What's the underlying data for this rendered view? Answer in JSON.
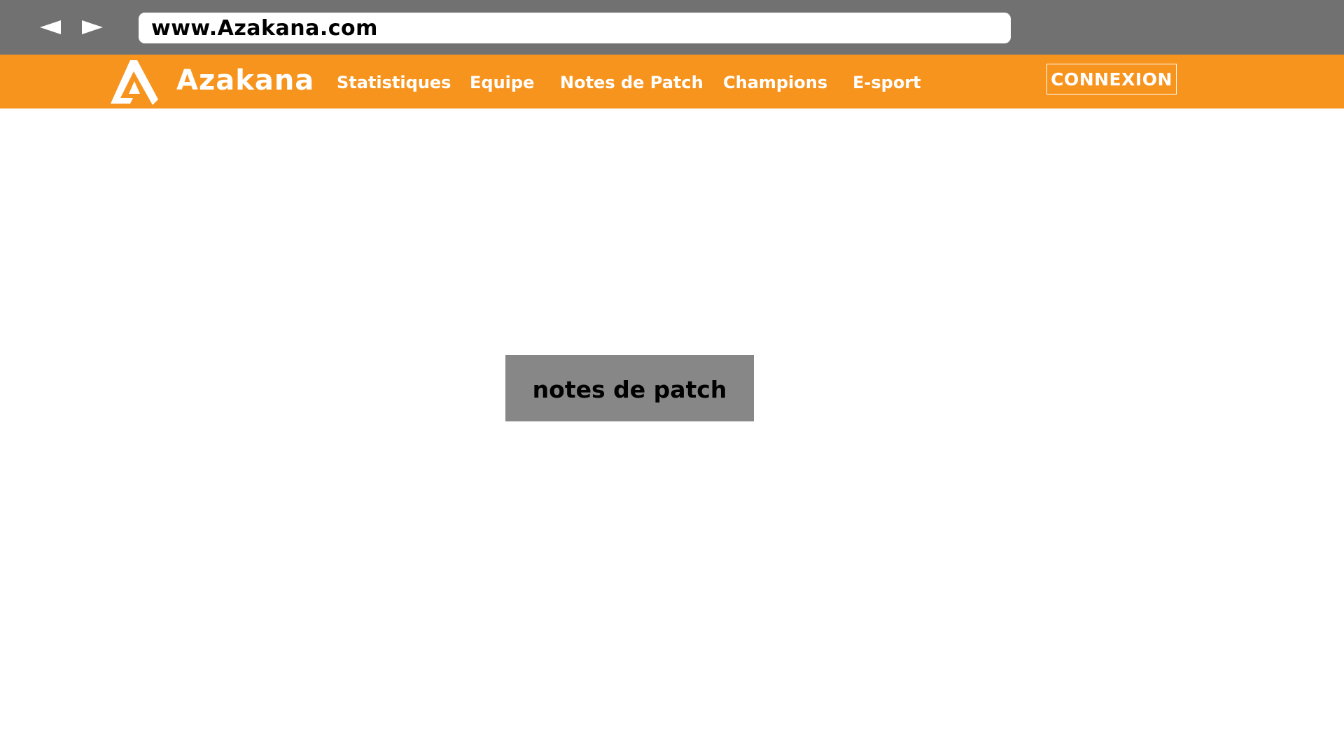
{
  "browser": {
    "back_icon": "triangle-left-icon",
    "forward_icon": "triangle-right-icon",
    "url": "www.Azakana.com"
  },
  "header": {
    "logo_icon": "azakana-a-logo",
    "brand": "Azakana",
    "nav": [
      {
        "label": "Statistiques"
      },
      {
        "label": "Equipe"
      },
      {
        "label": "Notes de Patch"
      },
      {
        "label": "Champions"
      },
      {
        "label": "E-sport"
      }
    ],
    "login_label": "CONNEXION"
  },
  "main": {
    "placeholder_label": "notes de patch"
  },
  "colors": {
    "browser_chrome": "#717171",
    "brand_orange": "#f7941e",
    "placeholder_gray": "#878787",
    "text_white": "#ffffff",
    "text_black": "#000000"
  }
}
